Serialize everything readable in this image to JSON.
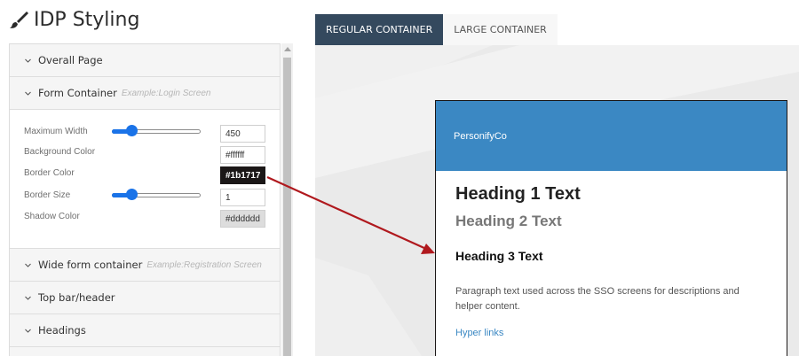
{
  "page": {
    "title": "IDP Styling",
    "title_icon": "paintbrush-icon"
  },
  "sidebar": {
    "sections": [
      {
        "label": "Overall Page",
        "example": ""
      },
      {
        "label": "Form Container",
        "example": "Example:Login Screen"
      },
      {
        "label": "Wide form container",
        "example": "Example:Registration Screen"
      },
      {
        "label": "Top bar/header",
        "example": ""
      },
      {
        "label": "Headings",
        "example": ""
      }
    ],
    "form_container": {
      "max_width": {
        "label": "Maximum Width",
        "value": "450",
        "slider_level": 0.22
      },
      "background_color": {
        "label": "Background Color",
        "value": "#ffffff"
      },
      "border_color": {
        "label": "Border Color",
        "value": "#1b1717"
      },
      "border_size": {
        "label": "Border Size",
        "value": "1",
        "slider_level": 0.22
      },
      "shadow_color": {
        "label": "Shadow Color",
        "value": "#dddddd"
      }
    }
  },
  "tabs": [
    {
      "label": "REGULAR CONTAINER",
      "active": true
    },
    {
      "label": "LARGE CONTAINER",
      "active": false
    }
  ],
  "preview": {
    "brand": "PersonifyCo",
    "heading1": "Heading 1 Text",
    "heading2": "Heading 2 Text",
    "heading3": "Heading 3 Text",
    "paragraph": "Paragraph text used across the SSO screens for descriptions and helper content.",
    "link": "Hyper links"
  },
  "colors": {
    "accent": "#3b88c3",
    "tab_active": "#34495e",
    "arrow": "#b0191e",
    "slider": "#1a73e8"
  }
}
